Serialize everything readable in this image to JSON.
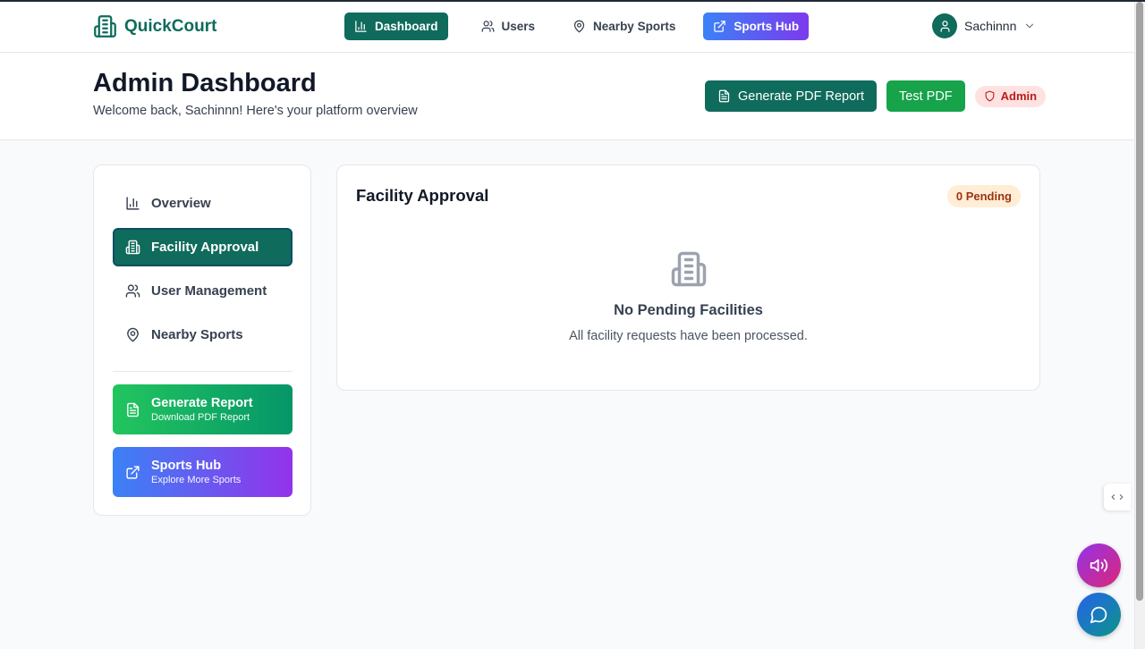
{
  "brand": {
    "name": "QuickCourt"
  },
  "nav": {
    "items": [
      {
        "label": "Dashboard",
        "icon": "bar-chart-icon",
        "active": true
      },
      {
        "label": "Users",
        "icon": "users-icon"
      },
      {
        "label": "Nearby Sports",
        "icon": "map-pin-icon"
      },
      {
        "label": "Sports Hub",
        "icon": "external-link-icon"
      }
    ]
  },
  "user": {
    "name": "Sachinnn"
  },
  "header": {
    "title": "Admin Dashboard",
    "subtitle": "Welcome back, Sachinnn! Here's your platform overview",
    "pdf_button": "Generate PDF Report",
    "test_button": "Test PDF",
    "role_badge": "Admin"
  },
  "sidebar": {
    "items": [
      {
        "label": "Overview",
        "icon": "bar-chart-icon"
      },
      {
        "label": "Facility Approval",
        "icon": "building-icon",
        "active": true
      },
      {
        "label": "User Management",
        "icon": "users-icon"
      },
      {
        "label": "Nearby Sports",
        "icon": "map-pin-icon"
      }
    ],
    "cards": [
      {
        "title": "Generate Report",
        "subtitle": "Download PDF Report",
        "icon": "file-text-icon"
      },
      {
        "title": "Sports Hub",
        "subtitle": "Explore More Sports",
        "icon": "external-link-icon"
      }
    ]
  },
  "main": {
    "title": "Facility Approval",
    "pending_badge": "0 Pending",
    "empty_title": "No Pending Facilities",
    "empty_text": "All facility requests have been processed."
  },
  "colors": {
    "primary": "#0f6b5c",
    "success": "#16a34a",
    "hub_gradient_start": "#3b82f6",
    "hub_gradient_end": "#9333ea",
    "admin_badge_bg": "#fee2e2",
    "pending_badge_bg": "#ffedd5"
  }
}
